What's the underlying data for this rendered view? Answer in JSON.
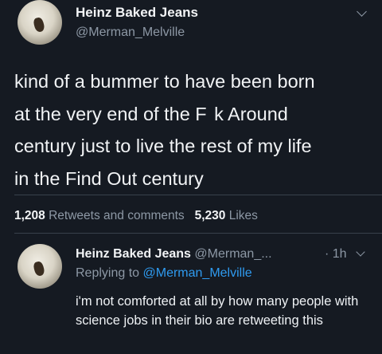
{
  "tweet": {
    "name": "Heinz Baked Jeans",
    "handle": "@Merman_Melville",
    "text": "kind of a bummer to have been born\nat the very end of the F  k Around\ncentury just to live the rest of my life\nin the Find Out century",
    "retweets_count": "1,208",
    "retweets_label": "Retweets and comments",
    "likes_count": "5,230",
    "likes_label": "Likes"
  },
  "reply": {
    "name": "Heinz Baked Jeans",
    "handle": "@Merman_...",
    "time": "· 1h",
    "replying_prefix": "Replying to",
    "replying_to": "@Merman_Melville",
    "text": "i'm not comforted at all by how many people with science jobs in their bio are retweeting this"
  },
  "colors": {
    "background": "#151a22",
    "link": "#2f9bf0",
    "secondary_text": "#8d98a5"
  }
}
